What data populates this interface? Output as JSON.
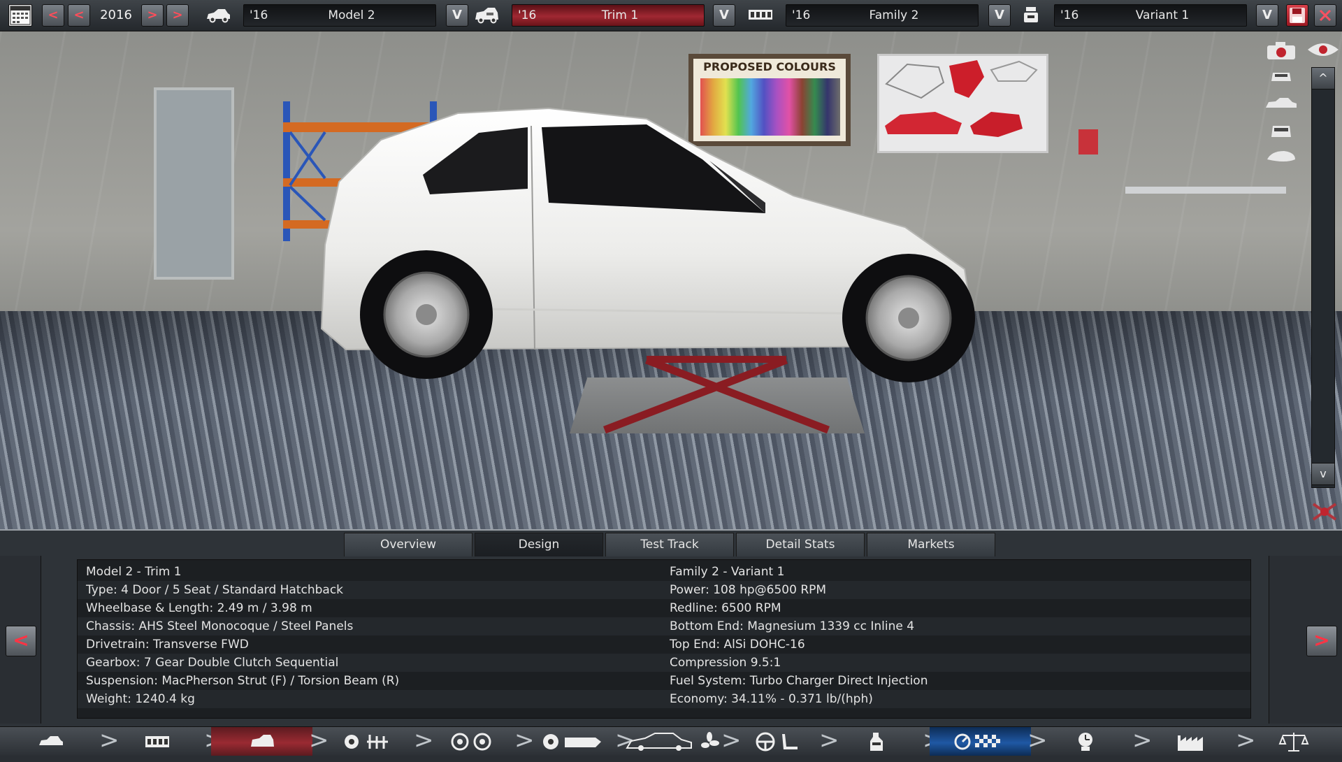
{
  "topbar": {
    "year": "2016",
    "prev_fast_label": "<",
    "prev_label": "<",
    "next_label": ">",
    "next_fast_label": ">",
    "dropdown_label": "V",
    "model": {
      "year": "'16",
      "name": "Model 2"
    },
    "trim": {
      "year": "'16",
      "name": "Trim 1"
    },
    "family": {
      "year": "'16",
      "name": "Family 2"
    },
    "variant": {
      "year": "'16",
      "name": "Variant 1"
    },
    "icons": [
      "calendar-icon",
      "car-model-icon",
      "car-trim-icon",
      "engine-family-icon",
      "engine-variant-icon",
      "save-icon",
      "close-icon"
    ]
  },
  "scene": {
    "poster_title": "PROPOSED COLOURS"
  },
  "sidebar": {
    "icons": [
      "camera-icon",
      "eye-icon",
      "car-front-view-icon",
      "car-side-view-icon",
      "car-rear-view-icon",
      "car-top-view-icon",
      "reset-view-icon"
    ],
    "scroll_up": "^",
    "scroll_down": "v"
  },
  "tabs": [
    {
      "label": "Overview"
    },
    {
      "label": "Design"
    },
    {
      "label": "Test Track"
    },
    {
      "label": "Detail Stats"
    },
    {
      "label": "Markets"
    }
  ],
  "active_tab": "Design",
  "info": {
    "left": [
      "Model 2 - Trim 1",
      "Type: 4 Door / 5 Seat / Standard Hatchback",
      "Wheelbase & Length: 2.49 m / 3.98 m",
      "Chassis: AHS Steel Monocoque / Steel Panels",
      "Drivetrain: Transverse FWD",
      "Gearbox: 7 Gear Double Clutch Sequential",
      "Suspension: MacPherson Strut (F) / Torsion Beam (R)",
      "Weight: 1240.4 kg"
    ],
    "right": [
      "Family 2 - Variant 1",
      "Power: 108 hp@6500 RPM",
      "Redline: 6500 RPM",
      "Bottom End: Magnesium 1339 cc Inline 4",
      "Top End: AlSi DOHC-16",
      "Compression 9.5:1",
      "Fuel System: Turbo Charger Direct Injection",
      "Economy: 34.11% - 0.371 lb/(hph)"
    ]
  },
  "pager": {
    "prev": "<",
    "next": ">"
  },
  "bottom_nav": {
    "chevron": ">",
    "items": [
      {
        "name": "car-model-nav",
        "icon": "car-icon"
      },
      {
        "name": "engine-family-nav",
        "icon": "engine-block-icon"
      },
      {
        "name": "trim-nav",
        "icon": "car-trim-icon"
      },
      {
        "name": "chassis-nav",
        "icon": "chassis-suspension-icon"
      },
      {
        "name": "wheels-nav",
        "icon": "wheels-icon"
      },
      {
        "name": "engine-parts-nav",
        "icon": "engine-parts-icon"
      },
      {
        "name": "body-design-nav",
        "icon": "car-body-fan-icon"
      },
      {
        "name": "interior-nav",
        "icon": "steering-seat-icon"
      },
      {
        "name": "fuel-nav",
        "icon": "fuel-system-icon"
      },
      {
        "name": "test-track-nav",
        "icon": "test-track-flag-icon"
      },
      {
        "name": "engineering-time-nav",
        "icon": "engineering-clock-icon"
      },
      {
        "name": "factory-nav",
        "icon": "factory-icon"
      },
      {
        "name": "compare-nav",
        "icon": "scales-icon"
      }
    ]
  },
  "colors": {
    "accent_red": "#a02832",
    "accent_blue": "#1f58a4",
    "panel_dark": "#1c1f22"
  }
}
